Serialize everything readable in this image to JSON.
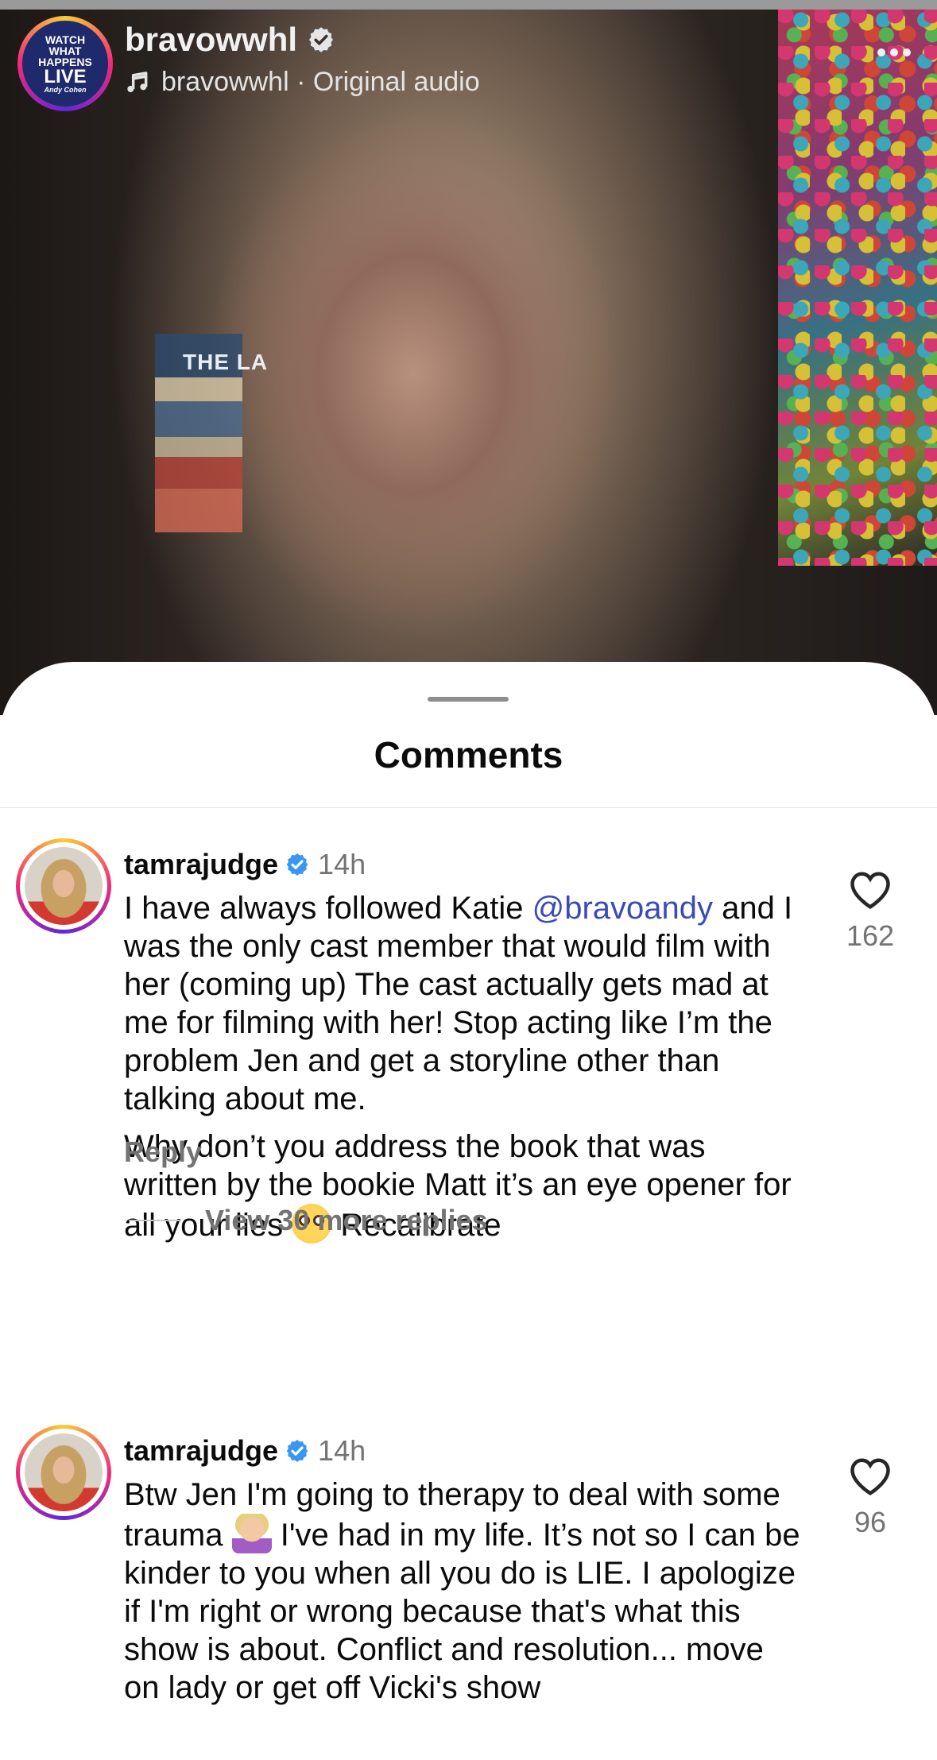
{
  "post": {
    "account_name": "bravowwhl",
    "audio_owner": "bravowwhl",
    "audio_separator": " · ",
    "audio_title": "Original audio",
    "avatar_logo": [
      "WATCH",
      "WHAT",
      "HAPPENS",
      "LIVE",
      "Andy Cohen"
    ],
    "video_book_text": "THE LA"
  },
  "sheet": {
    "title": "Comments"
  },
  "comments": [
    {
      "username": "tamrajudge",
      "time": "14h",
      "paragraphs": [
        {
          "before_mention": "I have always followed Katie ",
          "mention": "@bravoandy",
          "after_mention": " and I was the only cast member that would film with her (coming up) The cast actually gets mad at me for filming with her!  Stop acting like I’m the problem Jen and get a storyline other than talking about me."
        },
        {
          "before_emoji": "Why don’t you address the book that was written by the bookie Matt it’s an eye opener for all your lies ",
          "emoji": "flushed-face",
          "after_emoji": " Recalibrate"
        }
      ],
      "reply_label": "Reply",
      "likes": "162",
      "view_replies": "View 30 more replies"
    },
    {
      "username": "tamrajudge",
      "time": "14h",
      "before_emoji": "Btw Jen I'm going to therapy to deal with some trauma ",
      "emoji": "person-facepalming",
      "after_emoji": " I've had in my life. It’s not so I can be kinder to you when all you do is LIE. I apologize if I'm right or wrong because that's what this show is about. Conflict and resolution... move on lady or get off Vicki's show",
      "likes": "96"
    }
  ],
  "colors": {
    "mention": "#3a4ab6",
    "verified": "#3897f0",
    "secondary_text": "#737373"
  }
}
